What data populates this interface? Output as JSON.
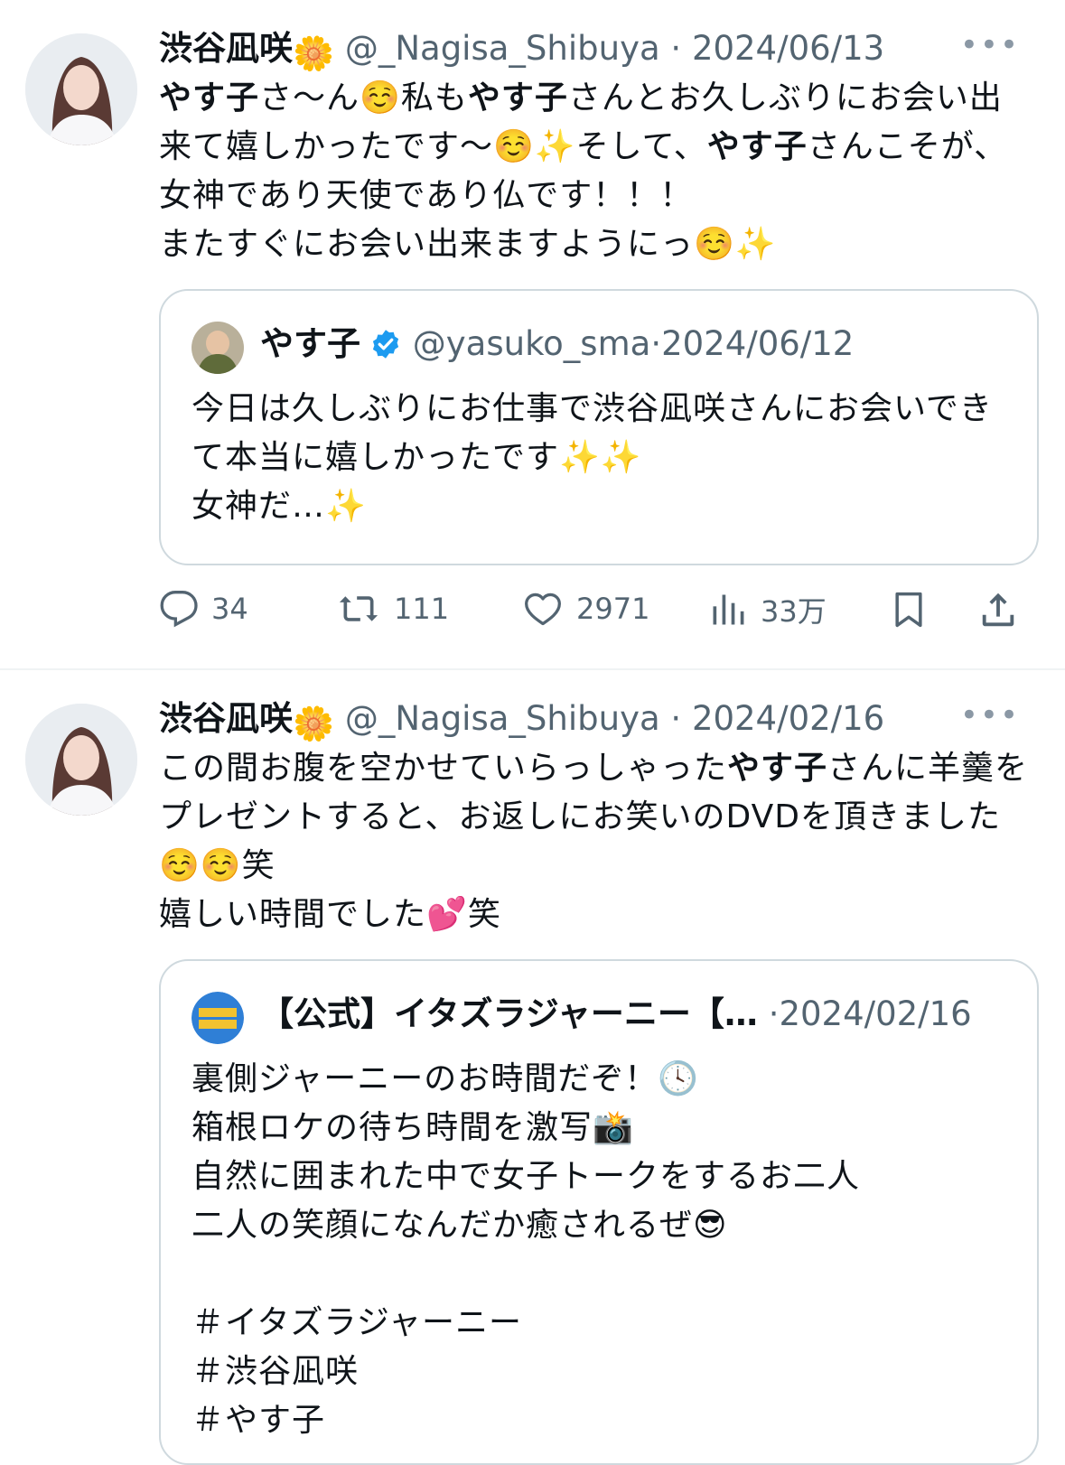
{
  "tweets": [
    {
      "display_name": "渋谷凪咲",
      "name_emoji": "🌼",
      "handle": "@_Nagisa_Shibuya",
      "separator": "·",
      "date": "2024/06/13",
      "more": "•••",
      "body_segments": [
        {
          "text": "やす子",
          "bold": true
        },
        {
          "text": "さ〜ん☺️私も",
          "bold": false
        },
        {
          "text": "やす子",
          "bold": true
        },
        {
          "text": "さんとお久しぶりにお会い出来て嬉しかったです〜☺️✨そして、",
          "bold": false
        },
        {
          "text": "やす子",
          "bold": true
        },
        {
          "text": "さんこそが、女神であり天使であり仏です！！！\nまたすぐにお会い出来ますようにっ☺️✨",
          "bold": false
        }
      ],
      "quote": {
        "name": "やす子",
        "handle": "@yasuko_sma",
        "date": "2024/06/12",
        "text": "今日は久しぶりにお仕事で渋谷凪咲さんにお会いできて本当に嬉しかったです✨✨\n女神だ…✨"
      },
      "stats": {
        "replies": "34",
        "retweets": "111",
        "likes": "2971",
        "views": "33万"
      }
    },
    {
      "display_name": "渋谷凪咲",
      "name_emoji": "🌼",
      "handle": "@_Nagisa_Shibuya",
      "separator": "·",
      "date": "2024/02/16",
      "more": "•••",
      "body_segments": [
        {
          "text": "この間お腹を空かせていらっしゃった",
          "bold": false
        },
        {
          "text": "やす子",
          "bold": true
        },
        {
          "text": "さんに羊羹をプレゼントすると、お返しにお笑いのDVDを頂きました☺️☺️笑\n嬉しい時間でした💕笑",
          "bold": false
        }
      ],
      "quote": {
        "name": "【公式】イタズラジャーニー【…",
        "handle": "",
        "date": "2024/02/16",
        "text": "裏側ジャーニーのお時間だぞ！🕓\n箱根ロケの待ち時間を激写📸\n自然に囲まれた中で女子トークをするお二人\n二人の笑顔になんだか癒されるぜ😎\n\n＃イタズラジャーニー\n＃渋谷凪咲\n＃やす子"
      }
    }
  ]
}
